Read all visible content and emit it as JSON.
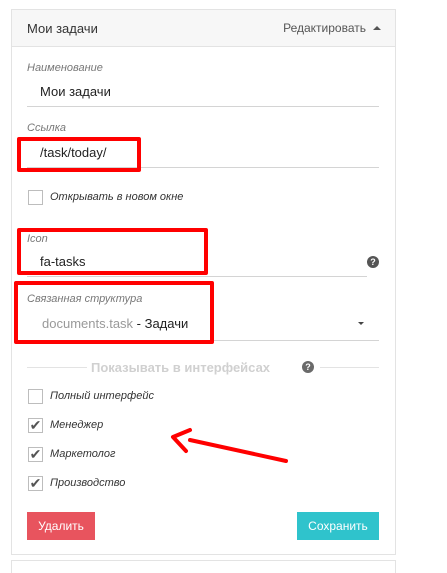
{
  "header": {
    "title": "Мои задачи",
    "edit_label": "Редактировать"
  },
  "form": {
    "name": {
      "label": "Наименование",
      "value": "Мои задачи"
    },
    "link": {
      "label": "Ссылка",
      "value": "/task/today/"
    },
    "new_window": {
      "label": "Открывать в новом окне",
      "checked": false
    },
    "icon": {
      "label": "Icon",
      "value": "fa-tasks",
      "help": "?"
    },
    "structure": {
      "label": "Связанная структура",
      "value_code": "documents.task",
      "value_name": " - Задачи"
    }
  },
  "interfaces": {
    "title": "Показывать в интерфейсах",
    "help": "?",
    "items": [
      {
        "label": "Полный интерфейс",
        "checked": false
      },
      {
        "label": "Менеджер",
        "checked": true
      },
      {
        "label": "Маркетолог",
        "checked": true
      },
      {
        "label": "Производство",
        "checked": true
      }
    ]
  },
  "buttons": {
    "delete_label": "Удалить",
    "save_label": "Сохранить"
  },
  "colors": {
    "delete": "#e8545e",
    "save": "#2fc3cc",
    "annotation": "#ff0000"
  }
}
